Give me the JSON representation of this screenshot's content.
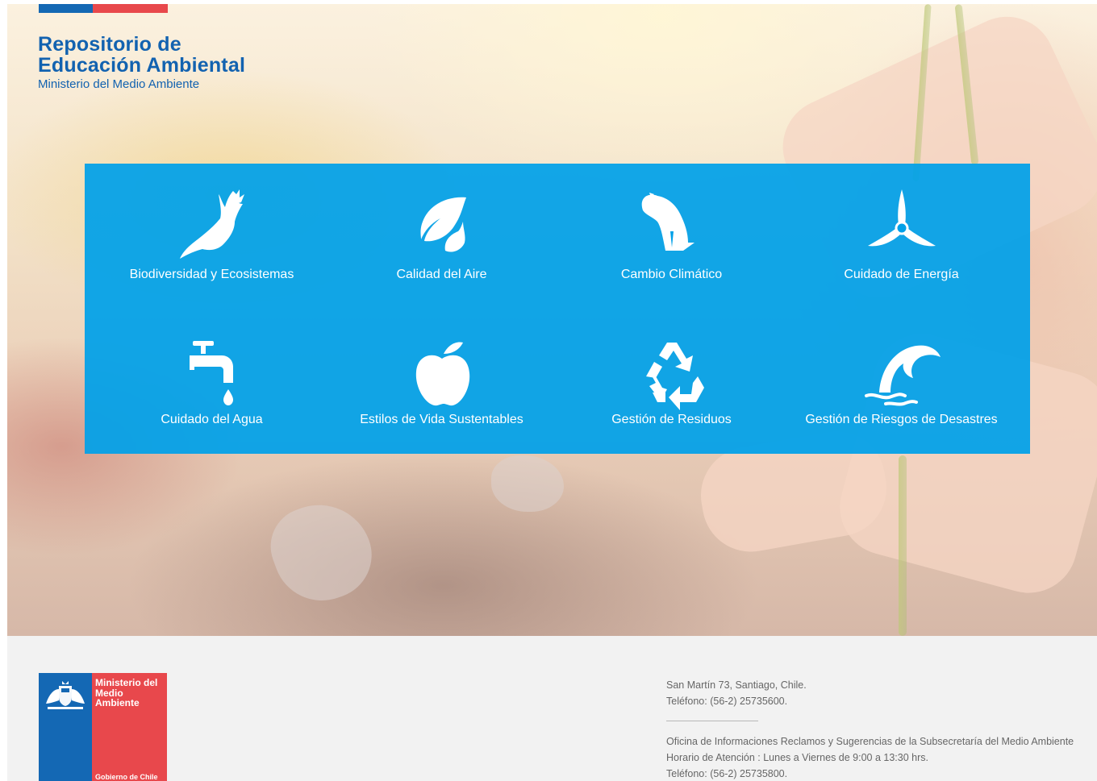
{
  "header": {
    "title_line1": "Repositorio de",
    "title_line2": "Educación Ambiental",
    "subtitle": "Ministerio del Medio Ambiente"
  },
  "categories": [
    {
      "label": "Biodiversidad y Ecosistemas",
      "icon": "eagle-icon"
    },
    {
      "label": "Calidad del Aire",
      "icon": "leaves-icon"
    },
    {
      "label": "Cambio Climático",
      "icon": "polar-bear-icon"
    },
    {
      "label": "Cuidado de Energía",
      "icon": "wind-turbine-icon"
    },
    {
      "label": "Cuidado del Agua",
      "icon": "faucet-icon"
    },
    {
      "label": "Estilos de Vida Sustentables",
      "icon": "apple-icon"
    },
    {
      "label": "Gestión de Residuos",
      "icon": "recycle-icon"
    },
    {
      "label": "Gestión de Riesgos de Desastres",
      "icon": "wave-icon"
    }
  ],
  "footer": {
    "logo_text": "Ministerio del Medio Ambiente",
    "logo_footer": "Gobierno de Chile",
    "address": "San Martín 73, Santiago, Chile.",
    "phone1": "Teléfono: (56-2) 25735600.",
    "office": "Oficina de Informaciones Reclamos y Sugerencias de la Subsecretaría del Medio Ambiente",
    "hours": "Horario de Atención : Lunes a Viernes de 9:00 a 13:30 hrs.",
    "phone2": "Teléfono: (56-2) 25735800."
  },
  "colors": {
    "panel_blue": "#00a0e8",
    "brand_blue": "#1468b4",
    "brand_red": "#e8484c"
  }
}
